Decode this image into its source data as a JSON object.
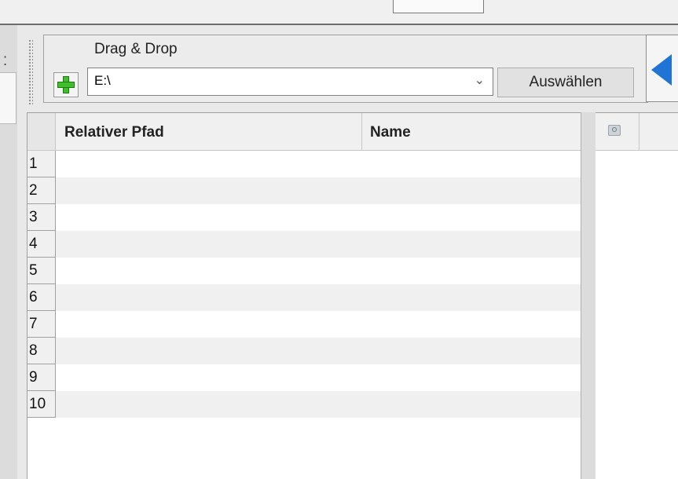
{
  "toolbar": {
    "title": "Drag & Drop",
    "add_icon": "plus-icon",
    "path_value": "E:\\",
    "select_label": "Auswählen",
    "back_icon": "triangle-left-icon"
  },
  "grid": {
    "columns": [
      "Relativer Pfad",
      "Name"
    ],
    "rows": [
      "1",
      "2",
      "3",
      "4",
      "5",
      "6",
      "7",
      "8",
      "9",
      "10"
    ]
  },
  "right_panel": {
    "header_icon": "image-preview-icon"
  },
  "colors": {
    "accent_blue": "#1f74d6",
    "add_green": "#3fbf2a"
  }
}
